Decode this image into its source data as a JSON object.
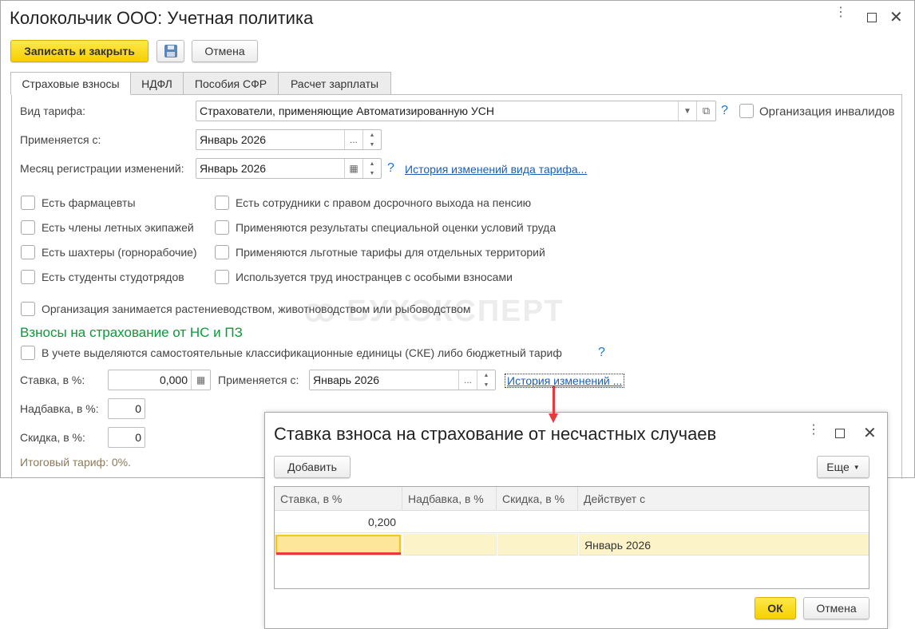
{
  "window": {
    "title": "Колокольчик ООО: Учетная политика"
  },
  "toolbar": {
    "save_close": "Записать и закрыть",
    "cancel": "Отмена"
  },
  "tabs": [
    "Страховые взносы",
    "НДФЛ",
    "Пособия СФР",
    "Расчет зарплаты"
  ],
  "form": {
    "tariff_label": "Вид тарифа:",
    "tariff_value": "Страхователи, применяющие Автоматизированную УСН",
    "help": "?",
    "disabled_org": "Организация инвалидов",
    "applies_label": "Применяется с:",
    "applies_value": "Январь 2026",
    "reg_month_label": "Месяц регистрации изменений:",
    "reg_month_value": "Январь 2026",
    "tariff_history": "История изменений вида тарифа...",
    "dots": "...",
    "checks_left": [
      "Есть фармацевты",
      "Есть члены летных экипажей",
      "Есть шахтеры (горнорабочие)",
      "Есть студенты студотрядов"
    ],
    "checks_right": [
      "Есть сотрудники с правом досрочного выхода на пенсию",
      "Применяются результаты специальной оценки условий труда",
      "Применяются льготные тарифы для отдельных территорий",
      "Используется труд иностранцев с особыми взносами"
    ],
    "agro": "Организация занимается растениеводством, животноводством или рыбоводством",
    "ns_heading": "Взносы на страхование от НС и ПЗ",
    "ske": "В учете выделяются самостоятельные классификационные единицы (СКЕ) либо бюджетный тариф",
    "rate_label": "Ставка, в %:",
    "rate_value": "0,000",
    "rate_applies_label": "Применяется с:",
    "rate_applies_value": "Январь 2026",
    "rate_history": "История изменений ...",
    "surcharge_label": "Надбавка, в %:",
    "surcharge_value": "0",
    "discount_label": "Скидка, в %:",
    "discount_value": "0",
    "total": "Итоговый тариф: 0%."
  },
  "watermark": "БУХЭКСПЕРТ",
  "dialog": {
    "title": "Ставка взноса на страхование от несчастных случаев",
    "add": "Добавить",
    "more": "Еще",
    "columns": [
      "Ставка, в %",
      "Надбавка, в %",
      "Скидка, в %",
      "Действует с"
    ],
    "rows": [
      [
        "0,200",
        "",
        "",
        ""
      ],
      [
        "",
        "",
        "",
        "Январь 2026"
      ]
    ],
    "ok": "ОК",
    "cancel": "Отмена"
  },
  "colors": {
    "accent_yellow": "#f5d000",
    "heading_green": "#0a9a3c",
    "link_blue": "#1a5fb4",
    "arrow_red": "#e8393c",
    "selected_row": "#fdf3c8"
  }
}
